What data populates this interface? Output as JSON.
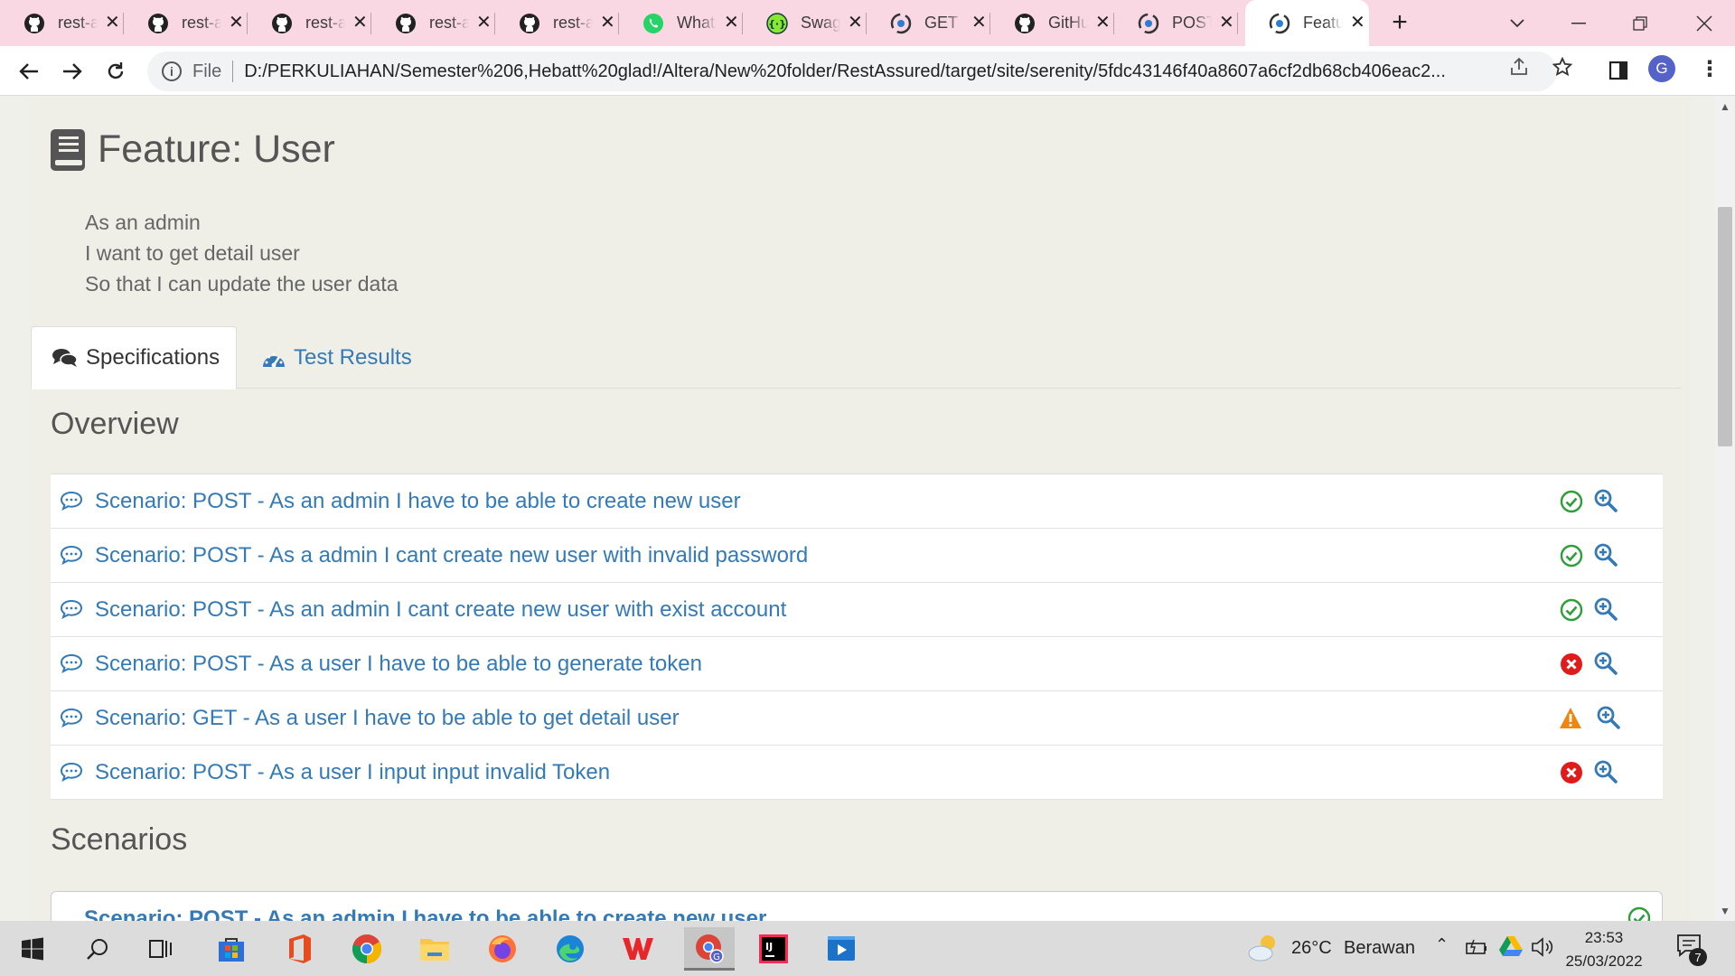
{
  "browser": {
    "tabs": [
      {
        "title": "rest-assured",
        "icon": "github-icon"
      },
      {
        "title": "rest-assured",
        "icon": "github-icon"
      },
      {
        "title": "rest-assured",
        "icon": "github-icon"
      },
      {
        "title": "rest-assured",
        "icon": "github-icon"
      },
      {
        "title": "rest-assured",
        "icon": "github-icon"
      },
      {
        "title": "WhatsApp",
        "icon": "whatsapp-icon"
      },
      {
        "title": "Swagger",
        "icon": "swagger-icon"
      },
      {
        "title": "GET",
        "icon": "serenity-icon"
      },
      {
        "title": "GitHub",
        "icon": "github-icon"
      },
      {
        "title": "POST",
        "icon": "serenity-icon"
      },
      {
        "title": "Feature",
        "icon": "serenity-icon",
        "active": true
      }
    ],
    "address": {
      "scheme_label": "File",
      "url": "D:/PERKULIAHAN/Semester%206,Hebatt%20glad!/Altera/New%20folder/RestAssured/target/site/serenity/5fdc43146f40a8607a6cf2db68cb406eac2..."
    },
    "profile_initial": "G"
  },
  "page": {
    "feature_title": "Feature: User",
    "narrative": [
      "As an admin",
      "I want to get detail user",
      "So that I can update the user data"
    ],
    "tabs": [
      {
        "label": "Specifications",
        "active": true
      },
      {
        "label": "Test Results",
        "active": false
      }
    ],
    "overview_heading": "Overview",
    "scenarios_heading": "Scenarios",
    "overview": [
      {
        "label": "Scenario: POST - As an admin I have to be able to create new user",
        "status": "passed"
      },
      {
        "label": "Scenario: POST - As a admin I cant create new user with invalid password",
        "status": "passed"
      },
      {
        "label": "Scenario: POST - As an admin I cant create new user with exist account",
        "status": "passed"
      },
      {
        "label": "Scenario: POST - As a user I have to be able to generate token",
        "status": "failed"
      },
      {
        "label": "Scenario: GET - As a user I have to be able to get detail user",
        "status": "warning"
      },
      {
        "label": "Scenario: POST - As a user I input input invalid Token",
        "status": "failed"
      }
    ],
    "first_scenario": {
      "label": "Scenario: POST - As an admin I have to be able to create new user",
      "status": "passed"
    }
  },
  "colors": {
    "link": "#337ab7",
    "passed": "#2e9e3a",
    "failed": "#e01b1b",
    "warning": "#f0870c"
  },
  "taskbar": {
    "weather_temp": "26°C",
    "weather_desc": "Berawan",
    "time": "23:53",
    "date": "25/03/2022",
    "notification_count": "7"
  }
}
